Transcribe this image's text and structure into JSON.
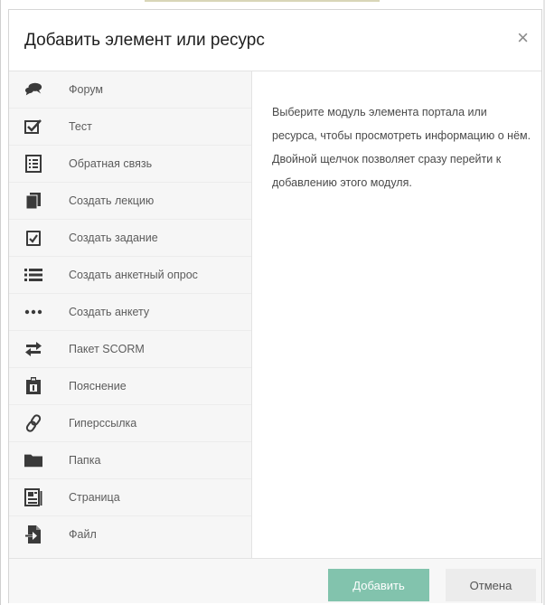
{
  "dialog": {
    "title": "Добавить элемент или ресурс",
    "close_glyph": "×"
  },
  "modules": [
    {
      "label": "Форум",
      "icon": "forum-icon"
    },
    {
      "label": "Тест",
      "icon": "quiz-icon"
    },
    {
      "label": "Обратная связь",
      "icon": "feedback-icon"
    },
    {
      "label": "Создать лекцию",
      "icon": "lesson-icon"
    },
    {
      "label": "Создать задание",
      "icon": "assignment-icon"
    },
    {
      "label": "Создать анкетный опрос",
      "icon": "survey-icon"
    },
    {
      "label": "Создать анкету",
      "icon": "questionnaire-icon"
    },
    {
      "label": "Пакет SCORM",
      "icon": "scorm-icon"
    },
    {
      "label": "Пояснение",
      "icon": "label-icon"
    },
    {
      "label": "Гиперссылка",
      "icon": "link-icon"
    },
    {
      "label": "Папка",
      "icon": "folder-icon"
    },
    {
      "label": "Страница",
      "icon": "page-icon"
    },
    {
      "label": "Файл",
      "icon": "file-icon"
    }
  ],
  "description": "Выберите модуль элемента портала или ресурса, чтобы просмотреть информацию о нём. Двойной щелчок позволяет сразу перейти к добавлению этого модуля.",
  "footer": {
    "add_label": "Добавить",
    "cancel_label": "Отмена"
  },
  "colors": {
    "add_button": "#82c3ad",
    "list_background": "#f6f6f6"
  }
}
